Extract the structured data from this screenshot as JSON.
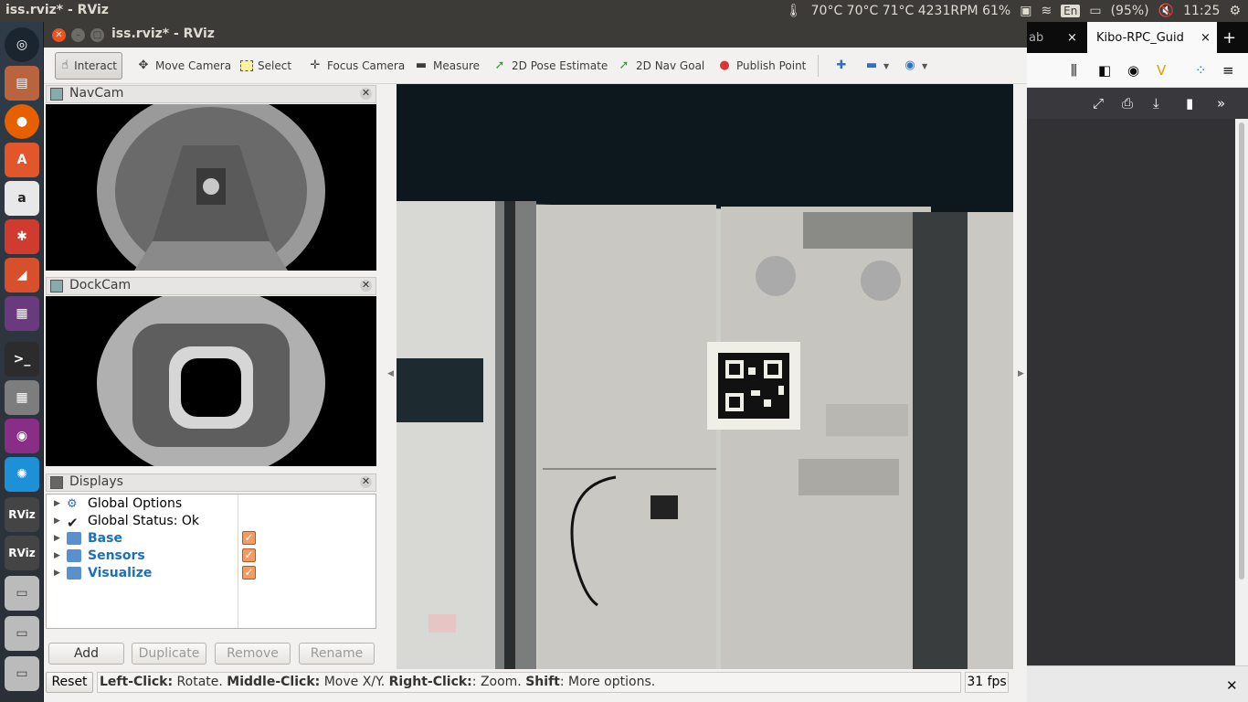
{
  "top_panel": {
    "title": "iss.rviz* - RViz",
    "temps": "70°C 70°C 71°C 4231RPM 61%",
    "lang": "En",
    "battery": "(95%)",
    "time": "11:25"
  },
  "launcher": {
    "items": [
      "dash-icon",
      "files-icon",
      "firefox-icon",
      "software-center-icon",
      "amazon-icon",
      "settings-icon",
      "app-icon",
      "workspace-icon",
      "terminal-icon",
      "calculator-icon",
      "screenshot-icon",
      "app-blue-icon",
      "rviz-icon",
      "rviz-icon-2",
      "drive-icon",
      "drive-icon-2",
      "drive-icon-3"
    ]
  },
  "firefox": {
    "tab_partial": "ab",
    "tab_active": "Kibo-RPC_Guid",
    "close": "×",
    "new_tab": "+"
  },
  "rviz": {
    "window_title": "iss.rviz* - RViz",
    "toolbar": {
      "interact": "Interact",
      "move_camera": "Move Camera",
      "select": "Select",
      "focus_camera": "Focus Camera",
      "measure": "Measure",
      "pose_estimate": "2D Pose Estimate",
      "nav_goal": "2D Nav Goal",
      "publish_point": "Publish Point"
    },
    "panels": {
      "navcam": "NavCam",
      "dockcam": "DockCam",
      "displays": "Displays"
    },
    "displays": [
      {
        "label": "Global Options",
        "checked": null
      },
      {
        "label": "Global Status: Ok",
        "checked": null
      },
      {
        "label": "Base",
        "checked": true
      },
      {
        "label": "Sensors",
        "checked": true
      },
      {
        "label": "Visualize",
        "checked": true
      }
    ],
    "buttons": {
      "add": "Add",
      "duplicate": "Duplicate",
      "remove": "Remove",
      "rename": "Rename"
    },
    "status": {
      "reset": "Reset",
      "left_click_key": "Left-Click:",
      "left_click_val": " Rotate. ",
      "middle_click_key": "Middle-Click:",
      "middle_click_val": " Move X/Y. ",
      "right_click_key": "Right-Click:",
      "right_click_val": ": Zoom. ",
      "shift_key": "Shift",
      "shift_val": ": More options.",
      "fps": "31 fps"
    }
  }
}
